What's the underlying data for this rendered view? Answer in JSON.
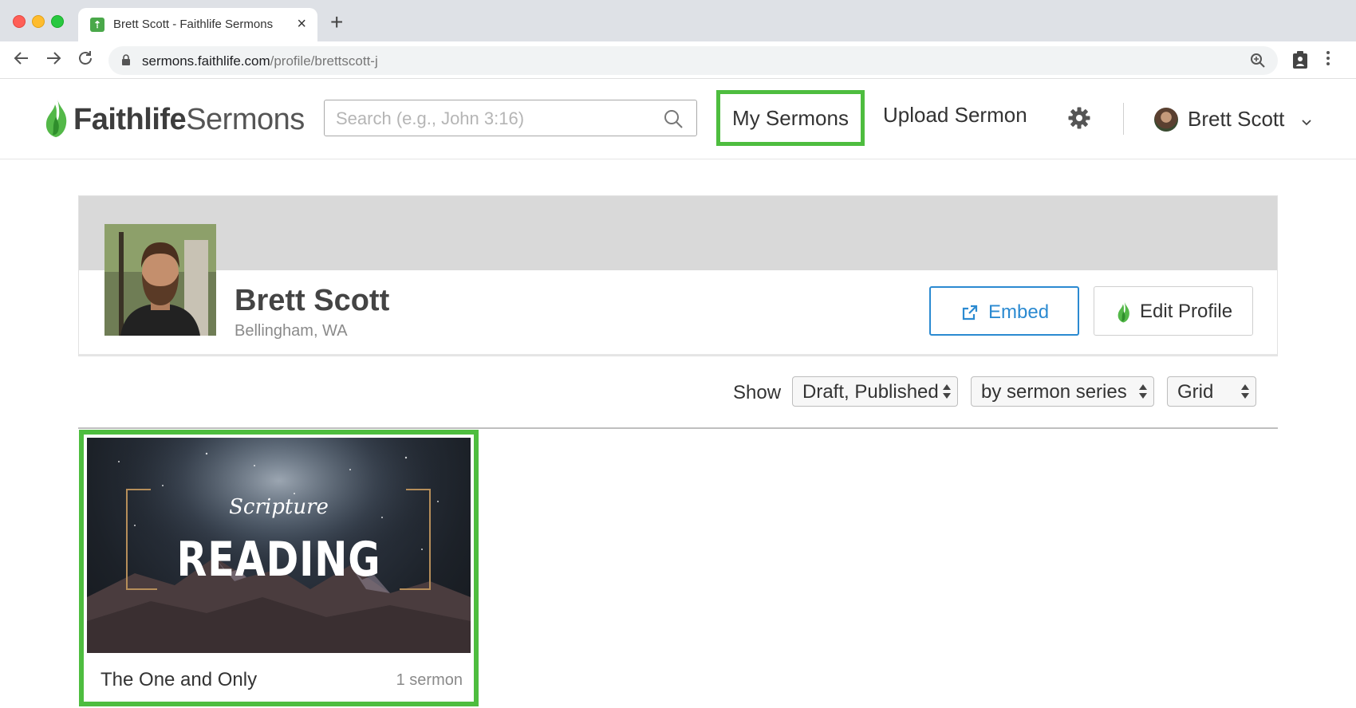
{
  "browser": {
    "tab_title": "Brett Scott - Faithlife Sermons",
    "tab_close": "×",
    "new_tab": "+",
    "url_host": "sermons.faithlife.com",
    "url_path": "/profile/brettscott-j"
  },
  "header": {
    "logo_bold": "Faithlife",
    "logo_light": "Sermons",
    "search_placeholder": "Search (e.g., John 3:16)",
    "nav": {
      "my_sermons": "My Sermons",
      "upload_sermon": "Upload Sermon"
    },
    "user_name": "Brett Scott"
  },
  "profile": {
    "name": "Brett Scott",
    "location": "Bellingham, WA",
    "embed_label": "Embed",
    "edit_label": "Edit Profile"
  },
  "filters": {
    "show_label": "Show",
    "status_value": "Draft, Published",
    "group_value": "by sermon series",
    "view_value": "Grid"
  },
  "series": [
    {
      "art_script": "Scripture",
      "art_title": "READING",
      "title": "The One and Only",
      "count": "1 sermon"
    }
  ],
  "colors": {
    "highlight_green": "#4ebd3f",
    "embed_blue": "#2b8ad1",
    "banner_gray": "#d9d9d9"
  },
  "icons": [
    "back-arrow-icon",
    "forward-arrow-icon",
    "reload-icon",
    "lock-icon",
    "zoom-icon",
    "extension-icon",
    "kebab-menu-icon",
    "search-icon",
    "gear-icon",
    "chevron-down-icon",
    "external-link-icon",
    "flame-icon"
  ]
}
